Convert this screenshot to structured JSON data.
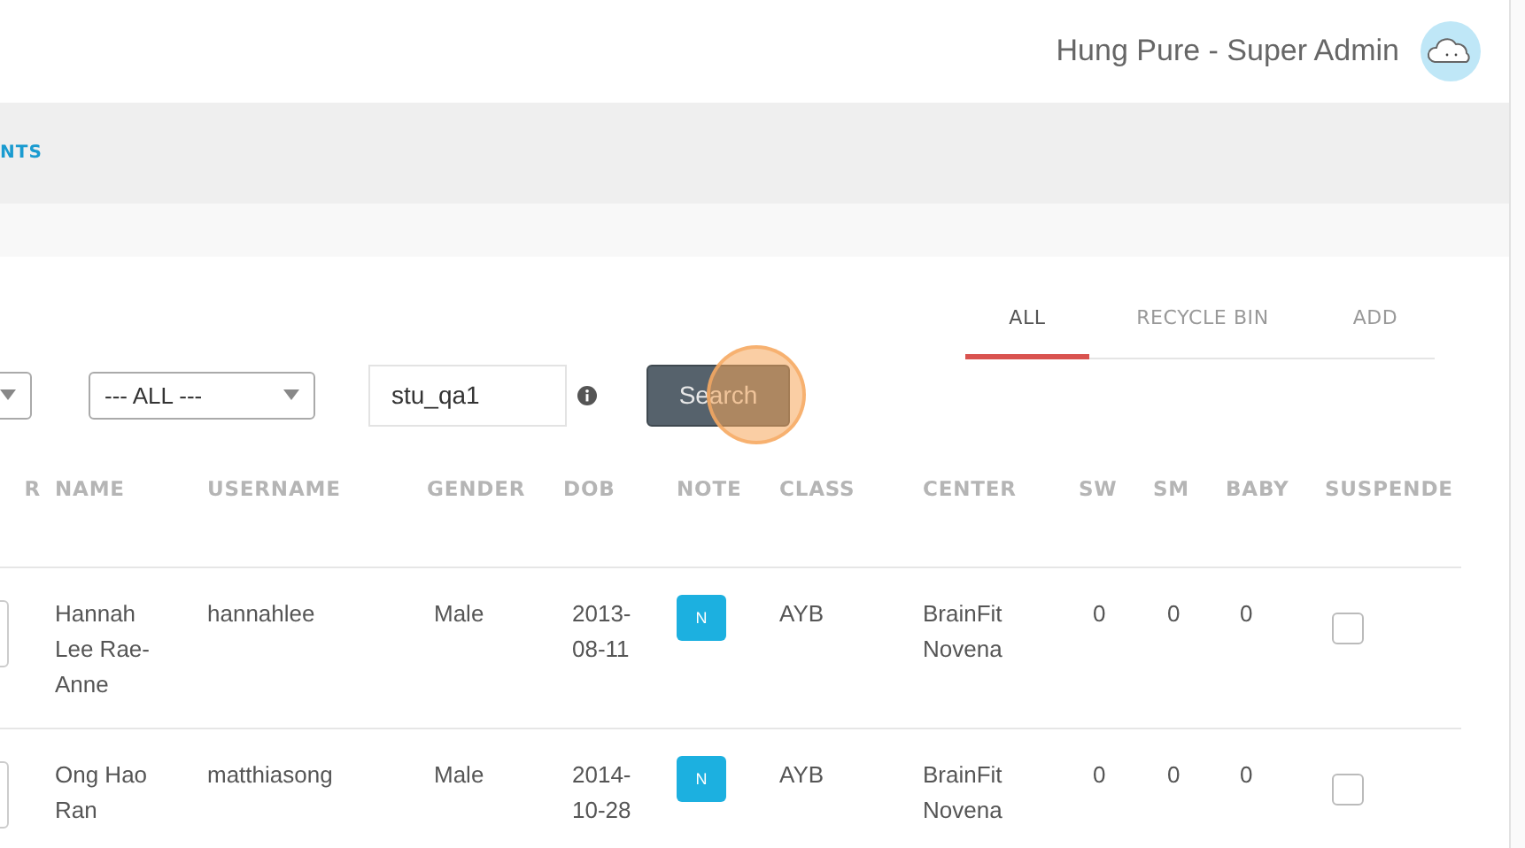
{
  "header": {
    "user_name": "Hung Pure - Super Admin"
  },
  "nav": {
    "items": [
      {
        "label": "NTS"
      }
    ]
  },
  "tabs": [
    {
      "label": "ALL",
      "selected": true
    },
    {
      "label": "RECYCLE BIN",
      "selected": false
    },
    {
      "label": "ADD",
      "selected": false
    }
  ],
  "filters": {
    "selects": [
      {
        "kind": "partial"
      },
      {
        "kind": "full",
        "value": "--- ALL ---"
      }
    ],
    "search_field": {
      "value": "stu_qa1"
    },
    "search_button": "Search"
  },
  "table": {
    "columns": [
      "R",
      "NAME",
      "USERNAME",
      "GENDER",
      "DOB",
      "NOTE",
      "CLASS",
      "CENTER",
      "SW",
      "SM",
      "BABY",
      "SUSPENDE"
    ],
    "rows": [
      {
        "name": "Hannah Lee Rae-Anne",
        "username": "hannahlee",
        "gender": "Male",
        "dob": "2013-08-11",
        "note": "N",
        "class": "AYB",
        "center": "BrainFit Novena",
        "sw": "0",
        "sm": "0",
        "baby": "0",
        "suspended": false
      },
      {
        "name": "Ong Hao Ran",
        "username": "matthiasong",
        "gender": "Male",
        "dob": "2014-10-28",
        "note": "N",
        "class": "AYB",
        "center": "BrainFit Novena",
        "sw": "0",
        "sm": "0",
        "baby": "0",
        "suspended": false
      }
    ]
  }
}
